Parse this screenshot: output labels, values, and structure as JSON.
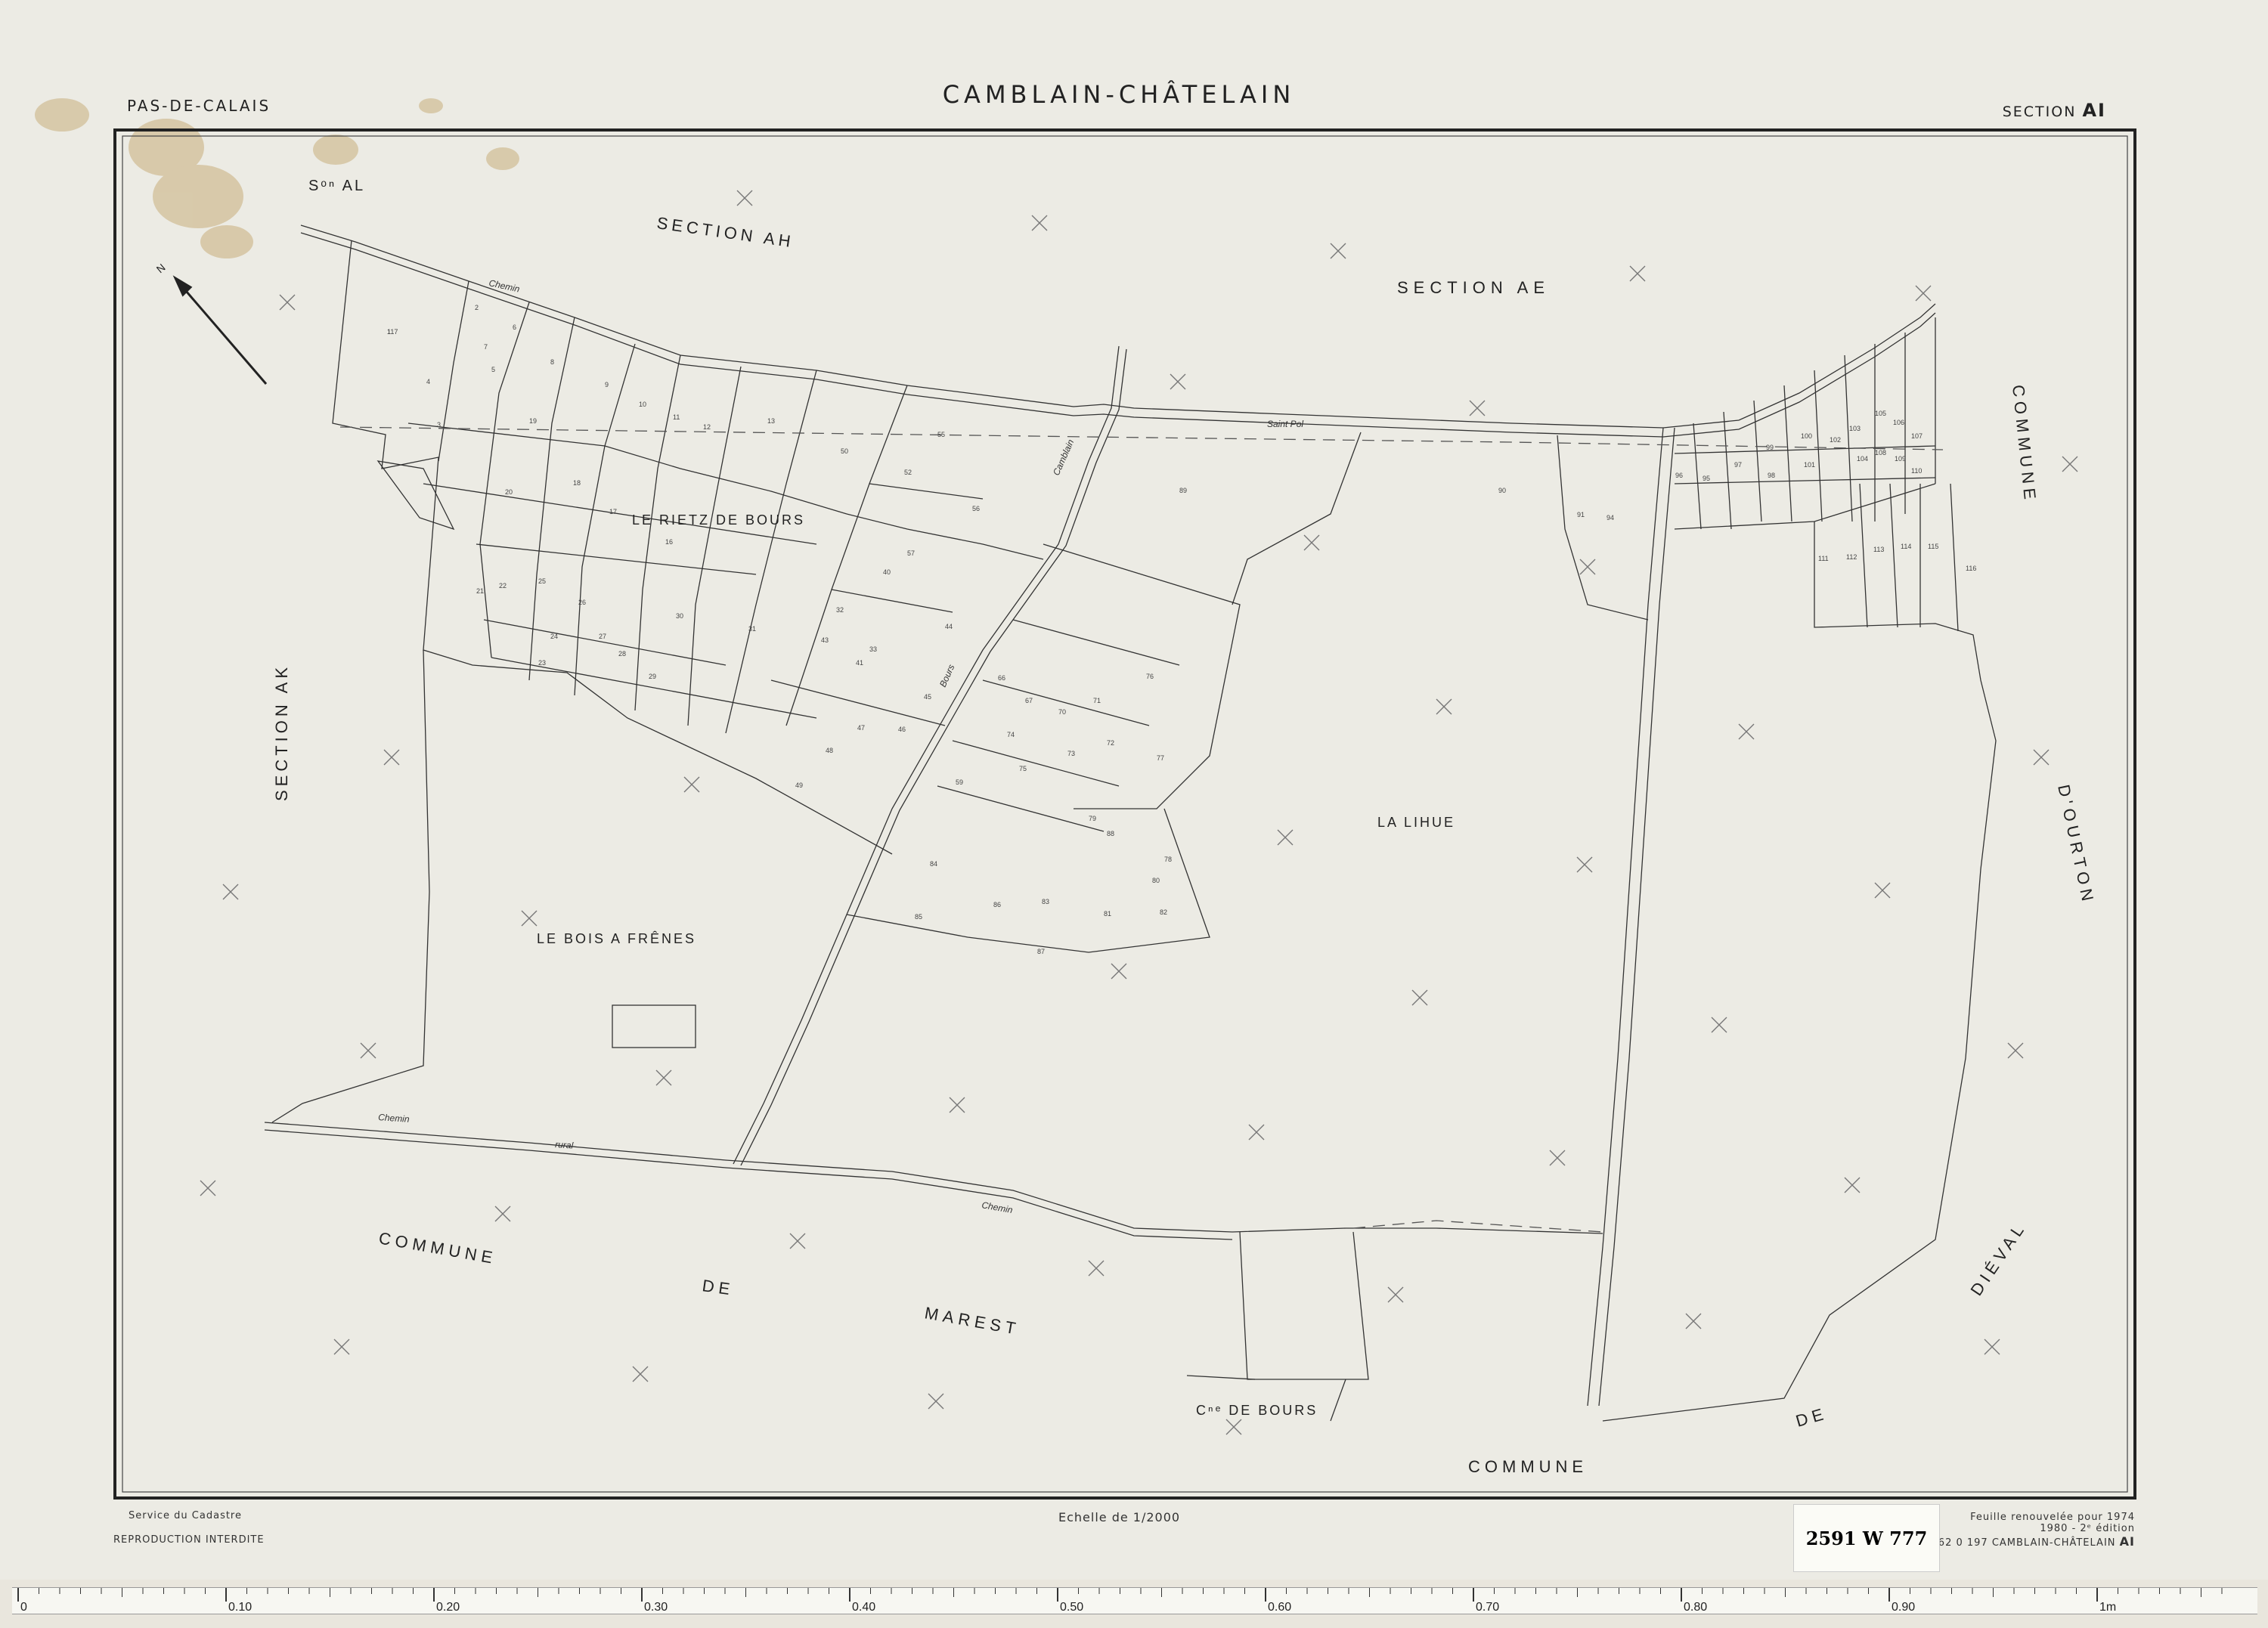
{
  "header": {
    "department": "PAS-DE-CALAIS",
    "commune": "CAMBLAIN-CHÂTELAIN",
    "section_prefix": "SECTION",
    "section_code": "AI"
  },
  "footer": {
    "service": "Service du Cadastre",
    "reproduction": "REPRODUCTION INTERDITE",
    "scale": "Echelle de 1/2000",
    "renewal_line1": "Feuille renouvelée pour 1974",
    "renewal_line2": "1980 - 2ᵉ édition",
    "code_prefix": "62 0 197",
    "code_name": "CAMBLAIN-CHÂTELAIN",
    "code_section": "AI"
  },
  "archive_stamp": "2591 W 777",
  "north": "N",
  "neighbours": {
    "section_al": "Sᵒⁿ AL",
    "section_ah": "SECTION AH",
    "section_ae": "SECTION AE",
    "section_ak": "SECTION AK",
    "commune_ourton_1": "COMMUNE",
    "commune_ourton_2": "D'OURTON",
    "commune_marest_1": "COMMUNE",
    "commune_marest_2": "DE",
    "commune_marest_3": "MAREST",
    "commune_dieval_1": "COMMUNE",
    "commune_dieval_2": "DE",
    "commune_dieval_3": "DIÉVAL"
  },
  "localities": {
    "rietz": "LE RIETZ DE BOURS",
    "bois": "LE BOIS A FRÊNES",
    "lihue": "LA LIHUE",
    "cne_bours": "Cⁿᵉ DE BOURS"
  },
  "roads": {
    "chemin_top": "Chemin",
    "chemin_mid": "Chemin",
    "chemin_bottom": "Chemin",
    "saint_pol": "Saint Pol",
    "rural": "rural",
    "camblain": "Camblain",
    "bours": "Bours"
  },
  "parcels": [
    "1",
    "2",
    "3",
    "4",
    "5",
    "6",
    "7",
    "8",
    "9",
    "10",
    "11",
    "12",
    "13",
    "16",
    "17",
    "18",
    "19",
    "20",
    "21",
    "22",
    "23",
    "24",
    "25",
    "26",
    "27",
    "28",
    "29",
    "30",
    "31",
    "32",
    "33",
    "40",
    "41",
    "43",
    "44",
    "45",
    "46",
    "47",
    "48",
    "49",
    "50",
    "52",
    "55",
    "56",
    "57",
    "59",
    "66",
    "67",
    "70",
    "71",
    "72",
    "73",
    "74",
    "75",
    "76",
    "77",
    "78",
    "79",
    "80",
    "81",
    "82",
    "83",
    "84",
    "85",
    "86",
    "87",
    "88",
    "89",
    "90",
    "91",
    "94",
    "95",
    "96",
    "97",
    "98",
    "99",
    "100",
    "101",
    "102",
    "103",
    "104",
    "105",
    "106",
    "107",
    "108",
    "109",
    "110",
    "111",
    "112",
    "113",
    "114",
    "115",
    "116",
    "117"
  ],
  "ruler": {
    "major_labels": [
      "0",
      "0.10",
      "0.20",
      "0.30",
      "0.40",
      "0.50",
      "0.60",
      "0.70",
      "0.80",
      "0.90",
      "1m"
    ]
  }
}
